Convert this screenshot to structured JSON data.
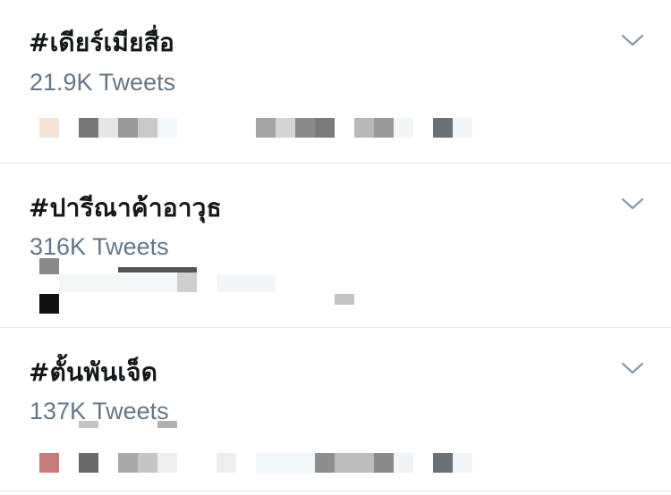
{
  "trends": [
    {
      "hashtag": "#เดียร์เมียสื่อ",
      "tweet_count": "21.9K Tweets"
    },
    {
      "hashtag": "#ปารีณาค้าอาวุธ",
      "tweet_count": "316K Tweets"
    },
    {
      "hashtag": "#ตั้นพันเจ็ด",
      "tweet_count": "137K Tweets"
    }
  ],
  "icons": {
    "more": "chevron-down-icon"
  },
  "colors": {
    "text_primary": "#14171a",
    "text_secondary": "#657786",
    "divider": "#e1e8ed",
    "chevron": "#8899a6"
  }
}
